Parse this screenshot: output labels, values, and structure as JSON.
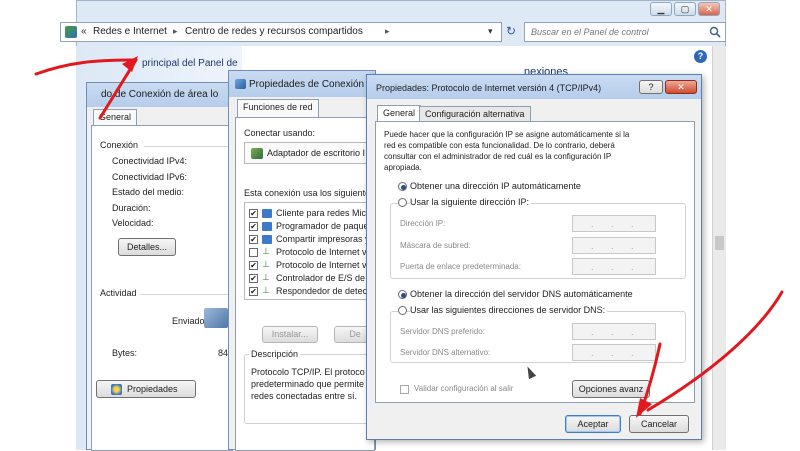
{
  "explorer": {
    "window_controls": {
      "minimize": "▁",
      "maximize": "▢",
      "close": "✕"
    },
    "nav": {
      "back": "◀",
      "forward": "▶",
      "dropdown": "▾"
    },
    "breadcrumb": {
      "prefix": "«",
      "item1": "Redes e Internet",
      "sep1": "▸",
      "item2": "Centro de redes y recursos compartidos",
      "sep2": "▸"
    },
    "address_dropdown": "▾",
    "refresh": "↻",
    "search": {
      "placeholder": "Buscar en el Panel de control",
      "icon": "search-icon"
    },
    "help": "?",
    "left_panel_title": "principal del Panel de",
    "right_heading_partial": "nexiones"
  },
  "status_dialog": {
    "title": "do de Conexión de área lo",
    "tab": "General",
    "connection_header": "Conexión",
    "rows": [
      "Conectividad IPv4:",
      "Conectividad IPv6:",
      "Estado del medio:",
      "Duración:",
      "Velocidad:"
    ],
    "details_button": "Detalles...",
    "activity_header": "Actividad",
    "sent_label": "Enviados",
    "bytes_label": "Bytes:",
    "bytes_value": "84",
    "properties_button": "Propiedades"
  },
  "props_dialog": {
    "title": "Propiedades de Conexión de",
    "tab": "Funciones de red",
    "connect_using": "Conectar usando:",
    "adapter": "Adaptador de escritorio I",
    "uses_label": "Esta conexión usa los siguiente",
    "items": [
      {
        "label": "Cliente para redes Mic",
        "checked": true
      },
      {
        "label": "Programador de paque",
        "checked": true
      },
      {
        "label": "Compartir impresoras y",
        "checked": true
      },
      {
        "label": "Protocolo de Internet v",
        "checked": false
      },
      {
        "label": "Protocolo de Internet v",
        "checked": true
      },
      {
        "label": "Controlador de E/S de",
        "checked": true
      },
      {
        "label": "Respondedor de detecc",
        "checked": true
      }
    ],
    "install_button": "Instalar...",
    "uninstall_button": "De",
    "description_header": "Descripción",
    "description_lines": [
      "Protocolo TCP/IP. El protoco",
      "predeterminado que permite",
      "redes conectadas entre sí."
    ]
  },
  "tcp_dialog": {
    "title": "Propiedades: Protocolo de Internet versión 4 (TCP/IPv4)",
    "help_button": "?",
    "close_button": "✕",
    "tabs": [
      "General",
      "Configuración alternativa"
    ],
    "intro_lines": [
      "Puede hacer que la configuración IP se asigne automáticamente si la",
      "red es compatible con esta funcionalidad. De lo contrario, deberá",
      "consultar con el administrador de red cuál es la configuración IP",
      "apropiada."
    ],
    "ip_auto": "Obtener una dirección IP automáticamente",
    "ip_manual": "Usar la siguiente dirección IP:",
    "ip_fields": [
      "Dirección IP:",
      "Máscara de subred:",
      "Puerta de enlace predeterminada:"
    ],
    "dns_auto": "Obtener la dirección del servidor DNS automáticamente",
    "dns_manual": "Usar las siguientes direcciones de servidor DNS:",
    "dns_fields": [
      "Servidor DNS preferido:",
      "Servidor DNS alternativo:"
    ],
    "validate_label": "Validar configuración al salir",
    "advanced_button": "Opciones avanz",
    "accept_button": "Aceptar",
    "cancel_button": "Cancelar",
    "ip_dot": "."
  },
  "colors": {
    "arrow": "#e0191e",
    "caption": "#b9cfeb",
    "accent": "#2a4f8a"
  }
}
